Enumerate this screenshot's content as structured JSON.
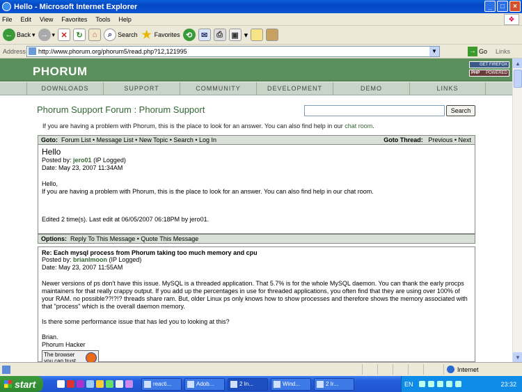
{
  "window": {
    "title": "Hello - Microsoft Internet Explorer"
  },
  "menu": [
    "File",
    "Edit",
    "View",
    "Favorites",
    "Tools",
    "Help"
  ],
  "toolbar": {
    "back": "Back",
    "search": "Search",
    "favorites": "Favorites"
  },
  "address": {
    "label": "Address",
    "url": "http://www.phorum.org/phorum5/read.php?12,121995",
    "go": "Go",
    "links": "Links"
  },
  "site": {
    "logo": "PHORUM",
    "badges": {
      "firefox": "GET FIREFOX",
      "php": "POWERED"
    },
    "nav": [
      "DOWNLOADS",
      "SUPPORT",
      "COMMUNITY",
      "DEVELOPMENT",
      "DEMO",
      "LINKS"
    ]
  },
  "forum": {
    "title": "Phorum Support Forum : Phorum Support",
    "search_button": "Search",
    "description": "If you are having a problem with Phorum, this is the place to look for an answer. You can also find help in our ",
    "chat_link": "chat room",
    "period": "."
  },
  "gotobar": {
    "label": "Goto:",
    "links": "Forum List • Message List • New Topic • Search • Log In",
    "thread_label": "Goto Thread:",
    "thread_links": "Previous • Next"
  },
  "message1": {
    "subject": "Hello",
    "posted_prefix": "Posted by: ",
    "author": "jero01",
    "ip": " (IP Logged)",
    "date": "Date: May 23, 2007 11:34AM",
    "greeting": "Hello,",
    "body": "If you are having a problem with Phorum, this is the place to look for an answer. You can also find help in our chat room.",
    "edited": "Edited 2 time(s). Last edit at 06/05/2007 06:18PM by jero01."
  },
  "optionsbar": {
    "label": "Options:",
    "links": "Reply To This Message • Quote This Message"
  },
  "message2": {
    "subject": "Re: Each mysql process from Phorum taking too much memory and cpu",
    "posted_prefix": "Posted by: ",
    "author": "brianlmoon",
    "ip": " (IP Logged)",
    "date": "Date: May 23, 2007 11:55AM",
    "p1": "Newer versions of ps don't have this issue. MySQL is a threaded application. That 5.7% is for the whole MySQL daemon. You can thank the early procps maintainers for that really crappy output. If you add up the percentages in use for threaded applications, you often find that they are using over 100% of your RAM. no possible??!?!? threads share ram. But, older Linux ps only knows how to show processes and therefore shows the memory associated with that \"process\" which is the overall daemon memory.",
    "p2": "Is there some performance issue that has led you to looking at this?",
    "sig1": "Brian.",
    "sig2": "Phorum Hacker",
    "sig_button": "The browser you can trust"
  },
  "status": {
    "zone": "Internet"
  },
  "taskbar": {
    "start": "start",
    "tasks": [
      "reacti...",
      "Adob...",
      "2 In...",
      "Wind...",
      "2 Ir..."
    ],
    "lang": "EN",
    "clock": "23:32"
  },
  "colors": {
    "header_green": "#5b8f5b",
    "link_green": "#336633",
    "titlebar_blue": "#0346c3"
  }
}
